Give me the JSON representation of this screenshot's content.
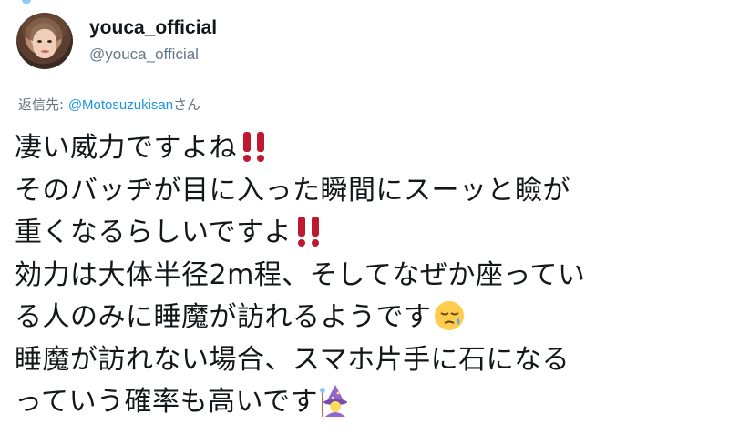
{
  "user": {
    "display_name": "youca_official",
    "handle": "@youca_official"
  },
  "reply": {
    "prefix": "返信先: ",
    "mention": "@Motosuzukisan",
    "suffix": "さん"
  },
  "tweet": {
    "lines": [
      "凄い威力ですよね",
      "そのバッヂが目に入った瞬間にスーッと瞼が",
      "重くなるらしいですよ",
      "効力は大体半径2m程、そしてなぜか座ってい",
      "る人のみに睡魔が訪れるようです",
      "睡魔が訪れない場合、スマホ片手に石になる",
      "っていう確率も高いです"
    ]
  },
  "emojis": {
    "line1": "double-exclamation-icon",
    "line3": "double-exclamation-icon",
    "line5": "sleepy-face-icon",
    "line7": "woman-mage-icon"
  },
  "colors": {
    "mention": "#1b95e0",
    "secondary_text": "#657786",
    "exclamation_red": "#be1931"
  }
}
